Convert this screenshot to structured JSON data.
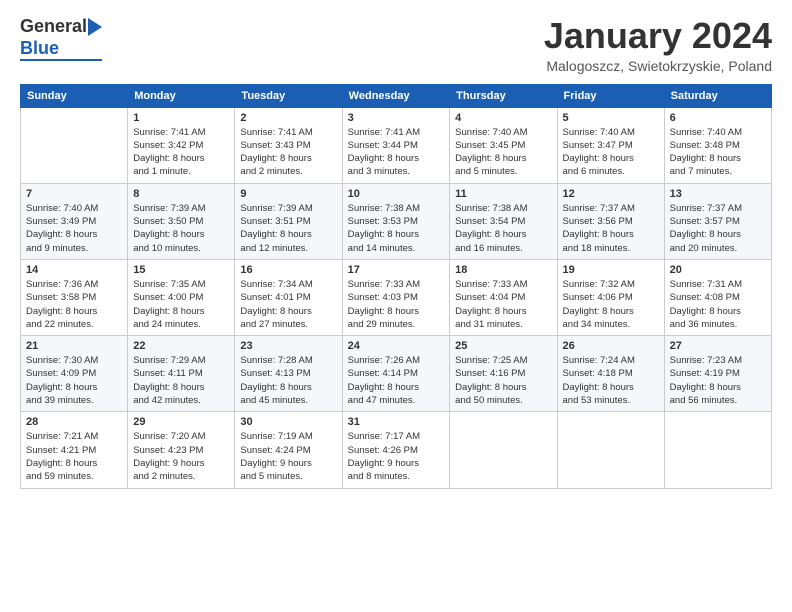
{
  "header": {
    "logo": {
      "line1": "General",
      "line2": "Blue"
    },
    "title": "January 2024",
    "location": "Malogoszcz, Swietokrzyskie, Poland"
  },
  "calendar": {
    "days_of_week": [
      "Sunday",
      "Monday",
      "Tuesday",
      "Wednesday",
      "Thursday",
      "Friday",
      "Saturday"
    ],
    "weeks": [
      [
        {
          "day": "",
          "info": ""
        },
        {
          "day": "1",
          "info": "Sunrise: 7:41 AM\nSunset: 3:42 PM\nDaylight: 8 hours\nand 1 minute."
        },
        {
          "day": "2",
          "info": "Sunrise: 7:41 AM\nSunset: 3:43 PM\nDaylight: 8 hours\nand 2 minutes."
        },
        {
          "day": "3",
          "info": "Sunrise: 7:41 AM\nSunset: 3:44 PM\nDaylight: 8 hours\nand 3 minutes."
        },
        {
          "day": "4",
          "info": "Sunrise: 7:40 AM\nSunset: 3:45 PM\nDaylight: 8 hours\nand 5 minutes."
        },
        {
          "day": "5",
          "info": "Sunrise: 7:40 AM\nSunset: 3:47 PM\nDaylight: 8 hours\nand 6 minutes."
        },
        {
          "day": "6",
          "info": "Sunrise: 7:40 AM\nSunset: 3:48 PM\nDaylight: 8 hours\nand 7 minutes."
        }
      ],
      [
        {
          "day": "7",
          "info": "Sunrise: 7:40 AM\nSunset: 3:49 PM\nDaylight: 8 hours\nand 9 minutes."
        },
        {
          "day": "8",
          "info": "Sunrise: 7:39 AM\nSunset: 3:50 PM\nDaylight: 8 hours\nand 10 minutes."
        },
        {
          "day": "9",
          "info": "Sunrise: 7:39 AM\nSunset: 3:51 PM\nDaylight: 8 hours\nand 12 minutes."
        },
        {
          "day": "10",
          "info": "Sunrise: 7:38 AM\nSunset: 3:53 PM\nDaylight: 8 hours\nand 14 minutes."
        },
        {
          "day": "11",
          "info": "Sunrise: 7:38 AM\nSunset: 3:54 PM\nDaylight: 8 hours\nand 16 minutes."
        },
        {
          "day": "12",
          "info": "Sunrise: 7:37 AM\nSunset: 3:56 PM\nDaylight: 8 hours\nand 18 minutes."
        },
        {
          "day": "13",
          "info": "Sunrise: 7:37 AM\nSunset: 3:57 PM\nDaylight: 8 hours\nand 20 minutes."
        }
      ],
      [
        {
          "day": "14",
          "info": "Sunrise: 7:36 AM\nSunset: 3:58 PM\nDaylight: 8 hours\nand 22 minutes."
        },
        {
          "day": "15",
          "info": "Sunrise: 7:35 AM\nSunset: 4:00 PM\nDaylight: 8 hours\nand 24 minutes."
        },
        {
          "day": "16",
          "info": "Sunrise: 7:34 AM\nSunset: 4:01 PM\nDaylight: 8 hours\nand 27 minutes."
        },
        {
          "day": "17",
          "info": "Sunrise: 7:33 AM\nSunset: 4:03 PM\nDaylight: 8 hours\nand 29 minutes."
        },
        {
          "day": "18",
          "info": "Sunrise: 7:33 AM\nSunset: 4:04 PM\nDaylight: 8 hours\nand 31 minutes."
        },
        {
          "day": "19",
          "info": "Sunrise: 7:32 AM\nSunset: 4:06 PM\nDaylight: 8 hours\nand 34 minutes."
        },
        {
          "day": "20",
          "info": "Sunrise: 7:31 AM\nSunset: 4:08 PM\nDaylight: 8 hours\nand 36 minutes."
        }
      ],
      [
        {
          "day": "21",
          "info": "Sunrise: 7:30 AM\nSunset: 4:09 PM\nDaylight: 8 hours\nand 39 minutes."
        },
        {
          "day": "22",
          "info": "Sunrise: 7:29 AM\nSunset: 4:11 PM\nDaylight: 8 hours\nand 42 minutes."
        },
        {
          "day": "23",
          "info": "Sunrise: 7:28 AM\nSunset: 4:13 PM\nDaylight: 8 hours\nand 45 minutes."
        },
        {
          "day": "24",
          "info": "Sunrise: 7:26 AM\nSunset: 4:14 PM\nDaylight: 8 hours\nand 47 minutes."
        },
        {
          "day": "25",
          "info": "Sunrise: 7:25 AM\nSunset: 4:16 PM\nDaylight: 8 hours\nand 50 minutes."
        },
        {
          "day": "26",
          "info": "Sunrise: 7:24 AM\nSunset: 4:18 PM\nDaylight: 8 hours\nand 53 minutes."
        },
        {
          "day": "27",
          "info": "Sunrise: 7:23 AM\nSunset: 4:19 PM\nDaylight: 8 hours\nand 56 minutes."
        }
      ],
      [
        {
          "day": "28",
          "info": "Sunrise: 7:21 AM\nSunset: 4:21 PM\nDaylight: 8 hours\nand 59 minutes."
        },
        {
          "day": "29",
          "info": "Sunrise: 7:20 AM\nSunset: 4:23 PM\nDaylight: 9 hours\nand 2 minutes."
        },
        {
          "day": "30",
          "info": "Sunrise: 7:19 AM\nSunset: 4:24 PM\nDaylight: 9 hours\nand 5 minutes."
        },
        {
          "day": "31",
          "info": "Sunrise: 7:17 AM\nSunset: 4:26 PM\nDaylight: 9 hours\nand 8 minutes."
        },
        {
          "day": "",
          "info": ""
        },
        {
          "day": "",
          "info": ""
        },
        {
          "day": "",
          "info": ""
        }
      ]
    ]
  }
}
